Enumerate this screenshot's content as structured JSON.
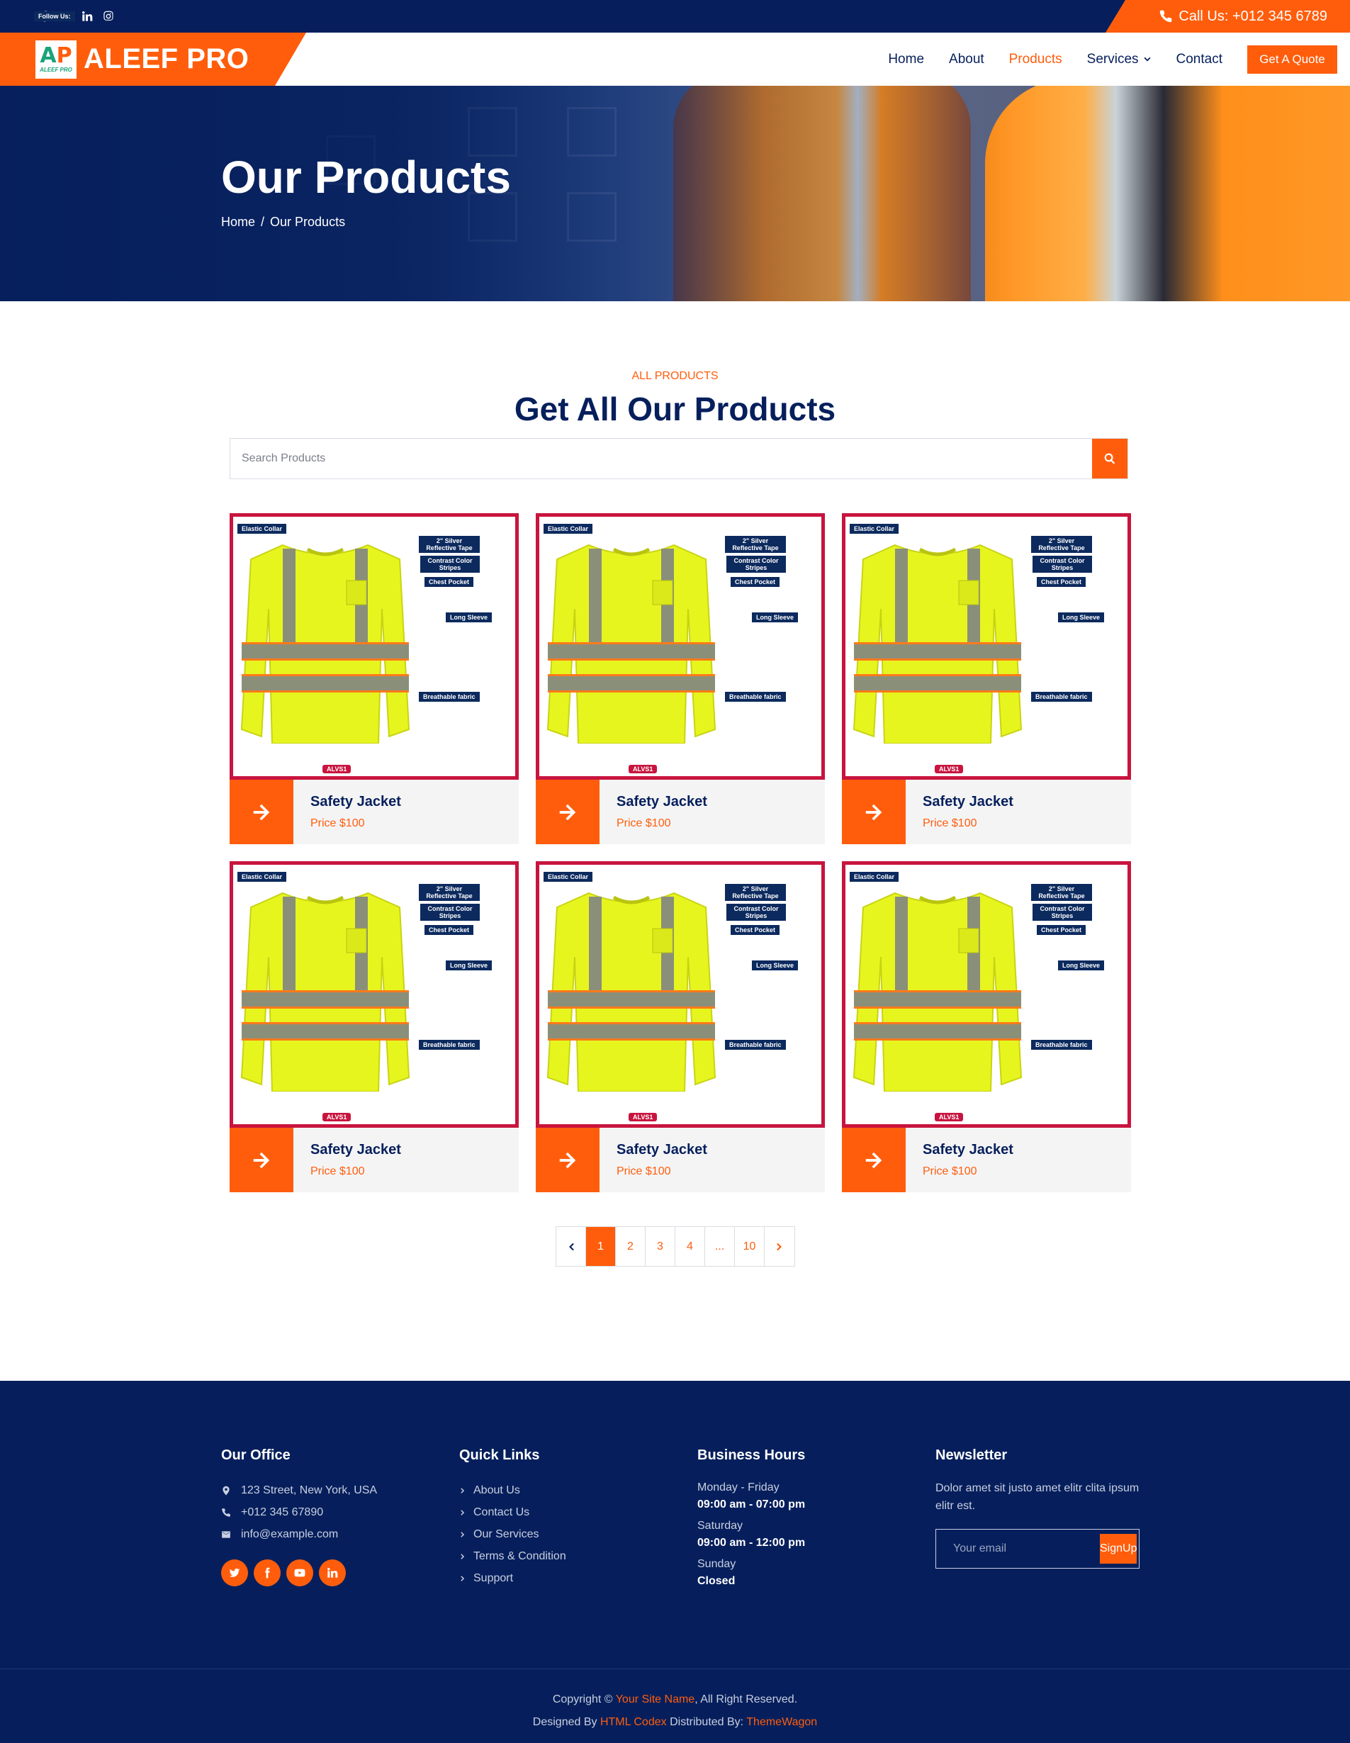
{
  "topbar": {
    "follow_label": "Follow Us:",
    "social_icons": [
      "facebook-icon",
      "twitter-icon",
      "linkedin-icon",
      "instagram-icon"
    ],
    "call_text": "Call Us: +012 345 6789"
  },
  "nav": {
    "brand": "ALEEF PRO",
    "logo_letters": "AP",
    "logo_small": "ALEEF PRO",
    "items": [
      "Home",
      "About",
      "Products",
      "Services",
      "Contact"
    ],
    "active": "Products",
    "quote_button": "Get A Quote"
  },
  "hero": {
    "title": "Our Products",
    "breadcrumb": [
      "Home",
      "Our Products"
    ]
  },
  "products_section": {
    "subtitle": "ALL PRODUCTS",
    "title": "Get All Our Products",
    "search_placeholder": "Search Products"
  },
  "product_image_labels": {
    "collar": "Elastic Collar",
    "tape": "2\" Silver Reflective Tape",
    "stripes": "Contrast Color Stripes",
    "pocket": "Chest Pocket",
    "sleeve": "Long Sleeve",
    "fabric": "Breathable fabric",
    "code": "ALVS1"
  },
  "products": [
    {
      "name": "Safety Jacket",
      "price": "Price $100"
    },
    {
      "name": "Safety Jacket",
      "price": "Price $100"
    },
    {
      "name": "Safety Jacket",
      "price": "Price $100"
    },
    {
      "name": "Safety Jacket",
      "price": "Price $100"
    },
    {
      "name": "Safety Jacket",
      "price": "Price $100"
    },
    {
      "name": "Safety Jacket",
      "price": "Price $100"
    }
  ],
  "pagination": {
    "pages": [
      "1",
      "2",
      "3",
      "4",
      "...",
      "10"
    ],
    "active": "1"
  },
  "footer": {
    "office": {
      "title": "Our Office",
      "address": "123 Street, New York, USA",
      "phone": "+012 345 67890",
      "email": "info@example.com"
    },
    "quick_links": {
      "title": "Quick Links",
      "links": [
        "About Us",
        "Contact Us",
        "Our Services",
        "Terms & Condition",
        "Support"
      ]
    },
    "hours": {
      "title": "Business Hours",
      "rows": [
        {
          "day": "Monday - Friday",
          "time": "09:00 am - 07:00 pm"
        },
        {
          "day": "Saturday",
          "time": "09:00 am - 12:00 pm"
        },
        {
          "day": "Sunday",
          "time": "Closed"
        }
      ]
    },
    "newsletter": {
      "title": "Newsletter",
      "text": "Dolor amet sit justo amet elitr clita ipsum elitr est.",
      "placeholder": "Your email",
      "button": "SignUp"
    },
    "copyright": {
      "prefix": "Copyright ©",
      "site": "Your Site Name",
      "suffix": ", All Right Reserved.",
      "designed_by": "Designed By",
      "designer": "HTML Codex",
      "distributed_by": "Distributed By:",
      "distributor": "ThemeWagon"
    }
  },
  "colors": {
    "primary": "#ff5d0c",
    "dark": "#061f5c",
    "card_border": "#c8143e"
  }
}
